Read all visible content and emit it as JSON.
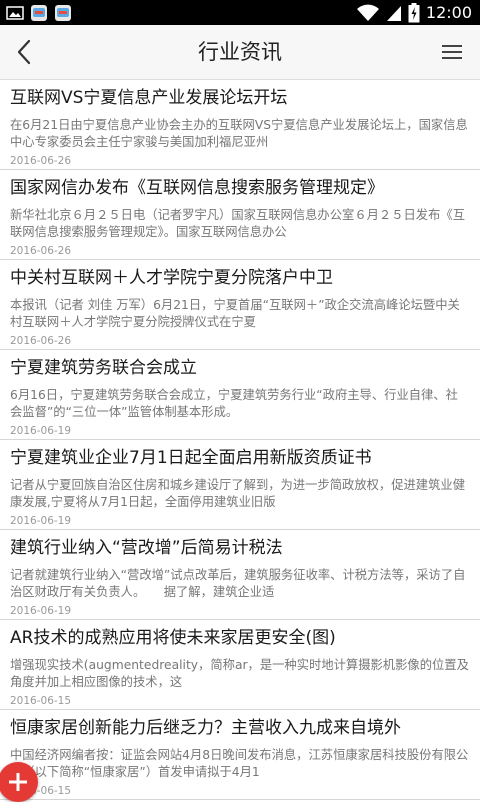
{
  "status_bar": {
    "time": "12:00",
    "icons": [
      "image-icon",
      "app-icon-1",
      "app-icon-2",
      "wifi-icon",
      "signal-icon",
      "battery-icon"
    ]
  },
  "app_bar": {
    "title": "行业资讯",
    "back_icon": "back-arrow-icon",
    "menu_icon": "menu-icon"
  },
  "news": [
    {
      "title": "互联网VS宁夏信息产业发展论坛开坛",
      "summary": "在6月21日由宁夏信息产业协会主办的互联网VS宁夏信息产业发展论坛上，国家信息中心专家委员会主任宁家骏与美国加利福尼亚州",
      "date": "2016-06-26"
    },
    {
      "title": "国家网信办发布《互联网信息搜索服务管理规定》",
      "summary": "新华社北京６月２５日电（记者罗宇凡）国家互联网信息办公室６月２５日发布《互联网信息搜索服务管理规定》。国家互联网信息办公",
      "date": "2016-06-26"
    },
    {
      "title": "中关村互联网＋人才学院宁夏分院落户中卫",
      "summary": "本报讯（记者 刘佳 万军）6月21日，宁夏首届“互联网＋”政企交流高峰论坛暨中关村互联网＋人才学院宁夏分院授牌仪式在宁夏",
      "date": "2016-06-26"
    },
    {
      "title": "宁夏建筑劳务联合会成立",
      "summary": "6月16日，宁夏建筑劳务联合会成立，宁夏建筑劳务行业“政府主导、行业自律、社会监督”的“三位一体”监管体制基本形成。",
      "date": "2016-06-19"
    },
    {
      "title": "宁夏建筑业企业7月1日起全面启用新版资质证书",
      "summary": "记者从宁夏回族自治区住房和城乡建设厅了解到，为进一步简政放权，促进建筑业健康发展,宁夏将从7月1日起，全面停用建筑业旧版",
      "date": "2016-06-19"
    },
    {
      "title": "建筑行业纳入“营改增”后简易计税法",
      "summary": "记者就建筑行业纳入“营改增”试点改革后，建筑服务征收率、计税方法等，采访了自治区财政厅有关负责人。　　据了解，建筑企业适",
      "date": "2016-06-19"
    },
    {
      "title": "AR技术的成熟应用将使未来家居更安全(图)",
      "summary": "增强现实技术(augmentedreality，简称ar，是一种实时地计算摄影机影像的位置及角度并加上相应图像的技术，这",
      "date": "2016-06-15"
    },
    {
      "title": "恒康家居创新能力后继乏力？主营收入九成来自境外",
      "summary": "中国经济网编者按：证监会网站4月8日晚间发布消息，江苏恒康家居科技股份有限公司（以下简称“恒康家居”）首发申请拟于4月1",
      "date": "2016-06-15"
    }
  ],
  "fab": {
    "icon": "plus-icon",
    "color": "#e53935"
  },
  "colors": {
    "status_bar": "#000000",
    "app_bar": "#f7f7f7",
    "title_text": "#1a1a1a",
    "summary_text": "#777777",
    "date_text": "#999999",
    "accent": "#e53935"
  }
}
